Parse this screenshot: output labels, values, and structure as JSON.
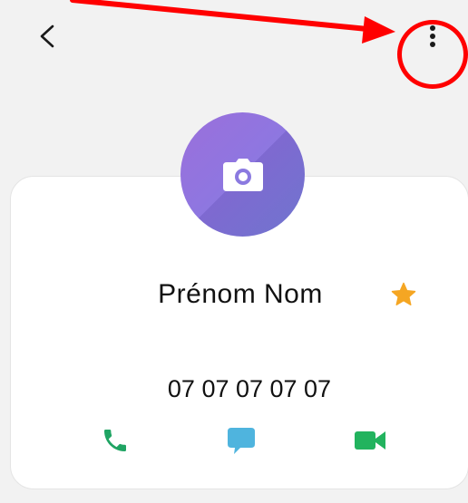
{
  "contact": {
    "name": "Prénom Nom",
    "phone": "07 07 07 07 07",
    "favorite": true
  },
  "header": {
    "back_icon": "chevron-left-icon",
    "more_icon": "more-vertical-icon"
  },
  "avatar": {
    "icon": "camera-icon"
  },
  "actions": [
    {
      "icon": "phone-icon",
      "color": "#1fa463"
    },
    {
      "icon": "message-icon",
      "color": "#4fb4de"
    },
    {
      "icon": "video-icon",
      "color": "#22b35e"
    }
  ],
  "colors": {
    "background": "#f2f2f2",
    "card": "#ffffff",
    "star": "#f5a623",
    "annotation": "#ff0000",
    "avatar_start": "#9b6fdb",
    "avatar_end": "#7b86dd"
  }
}
